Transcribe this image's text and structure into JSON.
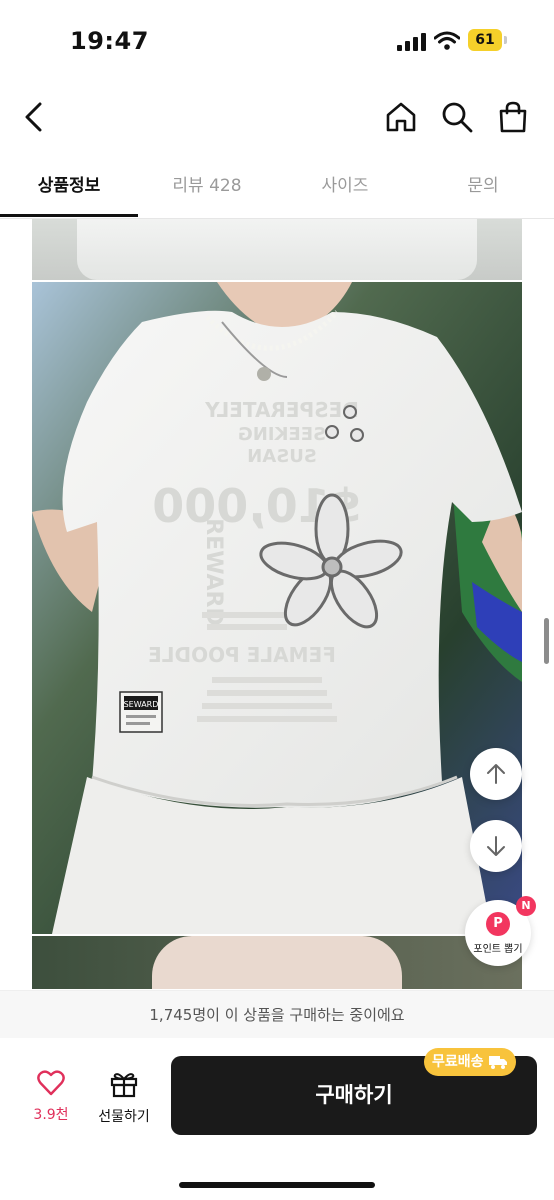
{
  "status_bar": {
    "time": "19:47",
    "battery": "61"
  },
  "tabs": [
    {
      "label": "상품정보"
    },
    {
      "label": "리뷰 428"
    },
    {
      "label": "사이즈"
    },
    {
      "label": "문의"
    }
  ],
  "tshirt_print": {
    "line1": "DESPERATELY",
    "line2": "SEEKING",
    "line3": "SUSAN",
    "price": "$10,000",
    "reward": "REWARD",
    "female": "FEMALE POODLE",
    "tag": "SEWARD"
  },
  "point_button": {
    "badge": "N",
    "icon": "P",
    "label": "포인트 뽑기"
  },
  "notice": "1,745명이 이 상품을 구매하는 중이에요",
  "bottom_bar": {
    "like_count": "3.9천",
    "gift_label": "선물하기",
    "buy_label": "구매하기",
    "shipping_badge": "무료배송"
  },
  "colors": {
    "accent": "#e0305b",
    "buy_bg": "#1a1a1a",
    "shipping": "#f8c33c"
  }
}
